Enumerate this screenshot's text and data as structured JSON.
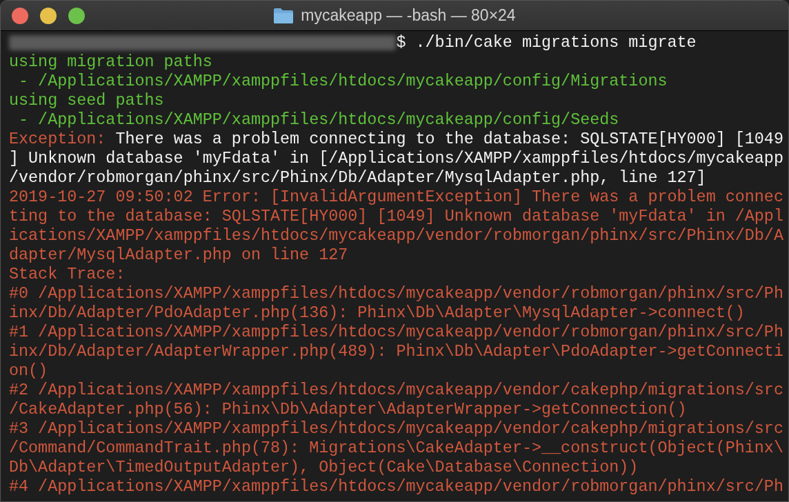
{
  "window": {
    "title": "mycakeapp — -bash — 80×24"
  },
  "lines": [
    {
      "segments": [
        {
          "kind": "redacted"
        },
        {
          "kind": "command",
          "text": "$ ./bin/cake migrations migrate"
        }
      ]
    },
    {
      "segments": [
        {
          "kind": "info",
          "text": "using migration paths"
        }
      ]
    },
    {
      "segments": [
        {
          "kind": "info",
          "text": " - /Applications/XAMPP/xamppfiles/htdocs/mycakeapp/config/Migrations"
        }
      ]
    },
    {
      "segments": [
        {
          "kind": "info",
          "text": "using seed paths"
        }
      ]
    },
    {
      "segments": [
        {
          "kind": "info",
          "text": " - /Applications/XAMPP/xamppfiles/htdocs/mycakeapp/config/Seeds"
        }
      ]
    },
    {
      "segments": [
        {
          "kind": "error",
          "text": "Exception: "
        },
        {
          "kind": "command",
          "text": "There was a problem connecting to the database: SQLSTATE[HY000] [1049"
        }
      ]
    },
    {
      "segments": [
        {
          "kind": "command",
          "text": "] Unknown database 'myFdata' in [/Applications/XAMPP/xamppfiles/htdocs/mycakeapp"
        }
      ]
    },
    {
      "segments": [
        {
          "kind": "command",
          "text": "/vendor/robmorgan/phinx/src/Phinx/Db/Adapter/MysqlAdapter.php, line 127]"
        }
      ]
    },
    {
      "segments": [
        {
          "kind": "error",
          "text": "2019-10-27 09:50:02 Error: [InvalidArgumentException] There was a problem connec"
        }
      ]
    },
    {
      "segments": [
        {
          "kind": "error",
          "text": "ting to the database: SQLSTATE[HY000] [1049] Unknown database 'myFdata' in /Appl"
        }
      ]
    },
    {
      "segments": [
        {
          "kind": "error",
          "text": "ications/XAMPP/xamppfiles/htdocs/mycakeapp/vendor/robmorgan/phinx/src/Phinx/Db/A"
        }
      ]
    },
    {
      "segments": [
        {
          "kind": "error",
          "text": "dapter/MysqlAdapter.php on line 127"
        }
      ]
    },
    {
      "segments": [
        {
          "kind": "error",
          "text": "Stack Trace:"
        }
      ]
    },
    {
      "segments": [
        {
          "kind": "error",
          "text": "#0 /Applications/XAMPP/xamppfiles/htdocs/mycakeapp/vendor/robmorgan/phinx/src/Ph"
        }
      ]
    },
    {
      "segments": [
        {
          "kind": "error",
          "text": "inx/Db/Adapter/PdoAdapter.php(136): Phinx\\Db\\Adapter\\MysqlAdapter->connect()"
        }
      ]
    },
    {
      "segments": [
        {
          "kind": "error",
          "text": "#1 /Applications/XAMPP/xamppfiles/htdocs/mycakeapp/vendor/robmorgan/phinx/src/Ph"
        }
      ]
    },
    {
      "segments": [
        {
          "kind": "error",
          "text": "inx/Db/Adapter/AdapterWrapper.php(489): Phinx\\Db\\Adapter\\PdoAdapter->getConnecti"
        }
      ]
    },
    {
      "segments": [
        {
          "kind": "error",
          "text": "on()"
        }
      ]
    },
    {
      "segments": [
        {
          "kind": "error",
          "text": "#2 /Applications/XAMPP/xamppfiles/htdocs/mycakeapp/vendor/cakephp/migrations/src"
        }
      ]
    },
    {
      "segments": [
        {
          "kind": "error",
          "text": "/CakeAdapter.php(56): Phinx\\Db\\Adapter\\AdapterWrapper->getConnection()"
        }
      ]
    },
    {
      "segments": [
        {
          "kind": "error",
          "text": "#3 /Applications/XAMPP/xamppfiles/htdocs/mycakeapp/vendor/cakephp/migrations/src"
        }
      ]
    },
    {
      "segments": [
        {
          "kind": "error",
          "text": "/Command/CommandTrait.php(78): Migrations\\CakeAdapter->__construct(Object(Phinx\\"
        }
      ]
    },
    {
      "segments": [
        {
          "kind": "error",
          "text": "Db\\Adapter\\TimedOutputAdapter), Object(Cake\\Database\\Connection))"
        }
      ]
    },
    {
      "segments": [
        {
          "kind": "error",
          "text": "#4 /Applications/XAMPP/xamppfiles/htdocs/mycakeapp/vendor/robmorgan/phinx/src/Ph"
        }
      ]
    }
  ]
}
